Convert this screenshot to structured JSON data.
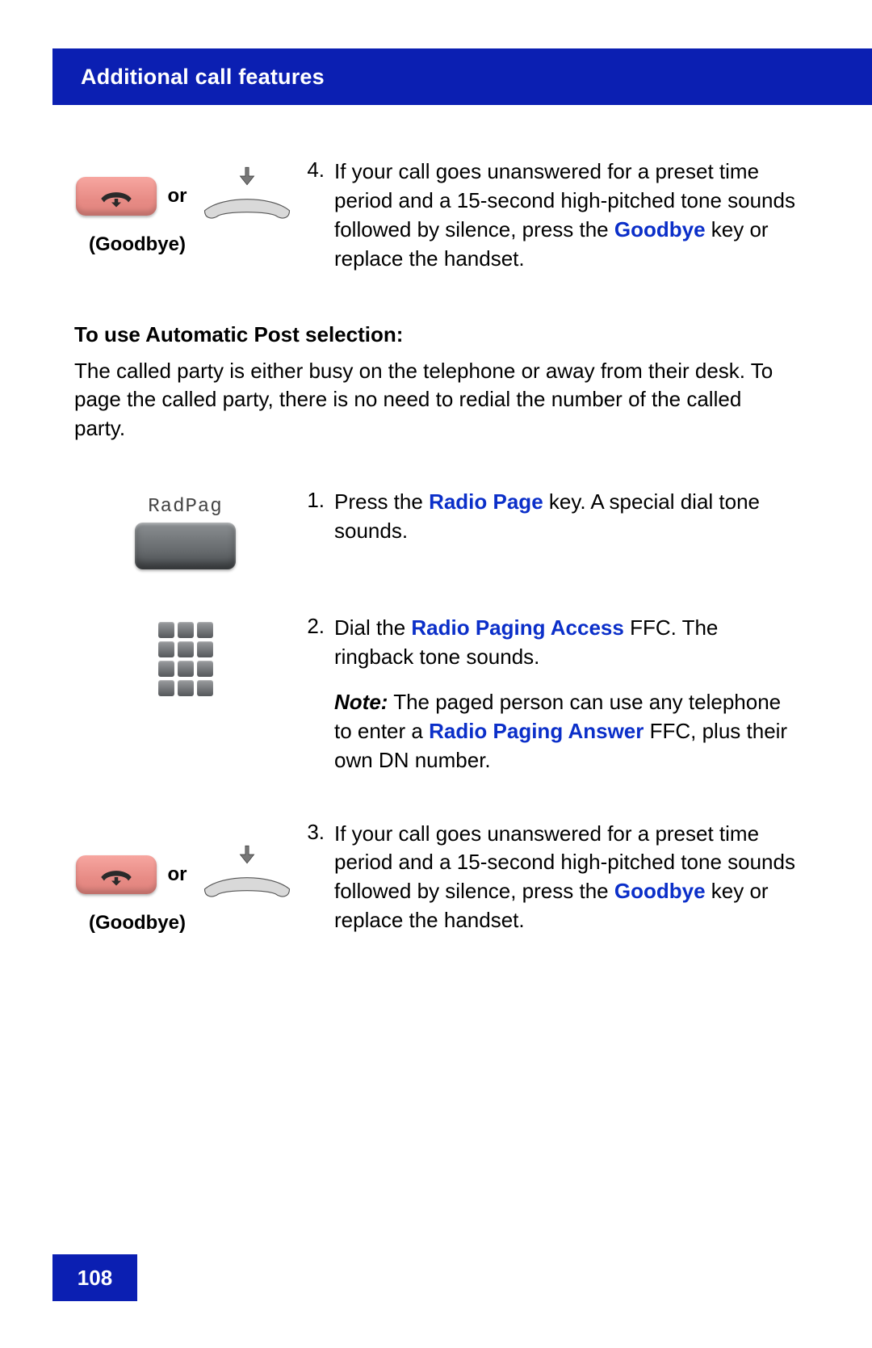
{
  "header": {
    "title": "Additional call features"
  },
  "step4": {
    "number": "4.",
    "text_before": "If your call goes unanswered for a preset time period and a 15-second high-pitched tone sounds followed by silence, press the ",
    "goodbye_word": "Goodbye",
    "text_after": " key or replace the handset.",
    "or_label": "or",
    "goodbye_label": "(Goodbye)"
  },
  "section": {
    "heading": "To use Automatic Post selection:",
    "intro": "The called party is either busy on the telephone or away from their desk. To page the called party, there is no need to redial the number of the called party."
  },
  "stepA": {
    "number": "1.",
    "radpag_label": "RadPag",
    "text_before": "Press the ",
    "radio_page": "Radio Page",
    "text_after": " key. A special dial tone sounds."
  },
  "stepB": {
    "number": "2.",
    "line1_before": "Dial the ",
    "radio_paging_access": "Radio Paging Access",
    "line1_after": " FFC. The ringback tone sounds.",
    "note_label": "Note:",
    "note_before": " The paged person can use any telephone to enter a ",
    "radio_paging_answer": "Radio Paging Answer",
    "note_after": " FFC, plus their own DN number."
  },
  "stepC": {
    "number": "3.",
    "text_before": "If your call goes unanswered for a preset time period and a 15-second high-pitched tone sounds followed by silence, press the ",
    "goodbye_word": "Goodbye",
    "text_after": " key or replace the handset.",
    "or_label": "or",
    "goodbye_label": "(Goodbye)"
  },
  "footer": {
    "page_number": "108"
  }
}
